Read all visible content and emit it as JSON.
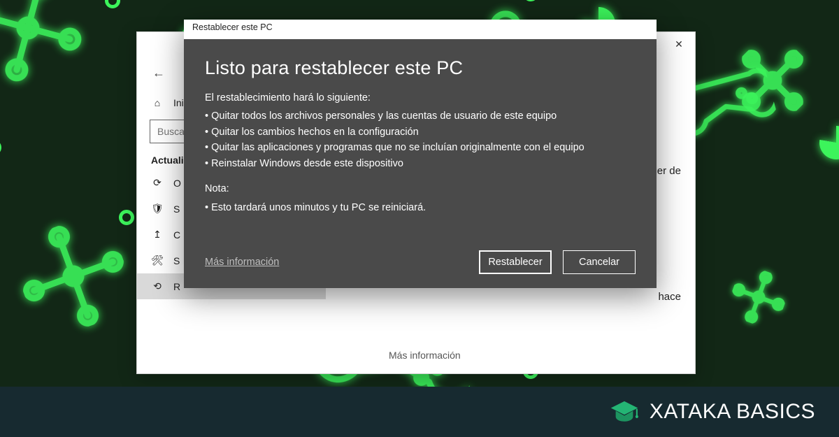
{
  "settings": {
    "close_tooltip": "Cerrar",
    "back_icon_name": "back-arrow",
    "home_label": "Inicio",
    "search_placeholder": "Buscar una opción",
    "heading": "Actualización y seguridad",
    "items": [
      {
        "icon": "sync-icon",
        "label": "O"
      },
      {
        "icon": "shield-icon",
        "label": "S"
      },
      {
        "icon": "upload-icon",
        "label": "C"
      },
      {
        "icon": "wrench-icon",
        "label": "S"
      },
      {
        "icon": "recovery-icon",
        "label": "R",
        "selected": true
      }
    ],
    "content_link": "Más información",
    "fragment_right_a": "er de",
    "fragment_right_b": "hace"
  },
  "dialog": {
    "window_title": "Restablecer este PC",
    "heading": "Listo para restablecer este PC",
    "intro": "El restablecimiento hará lo siguiente:",
    "bullets": [
      "Quitar todos los archivos personales y las cuentas de usuario de este equipo",
      "Quitar los cambios hechos en la configuración",
      " Quitar las aplicaciones y programas que no se incluían originalmente con el equipo",
      "Reinstalar Windows desde este dispositivo"
    ],
    "note_label": "Nota:",
    "note_bullets": [
      "Esto tardará unos minutos y tu PC se reiniciará."
    ],
    "more_info": "Más información",
    "primary_button": "Restablecer",
    "secondary_button": "Cancelar"
  },
  "brand": {
    "name": "XATAKA BASICS",
    "accent": "#24b574"
  }
}
